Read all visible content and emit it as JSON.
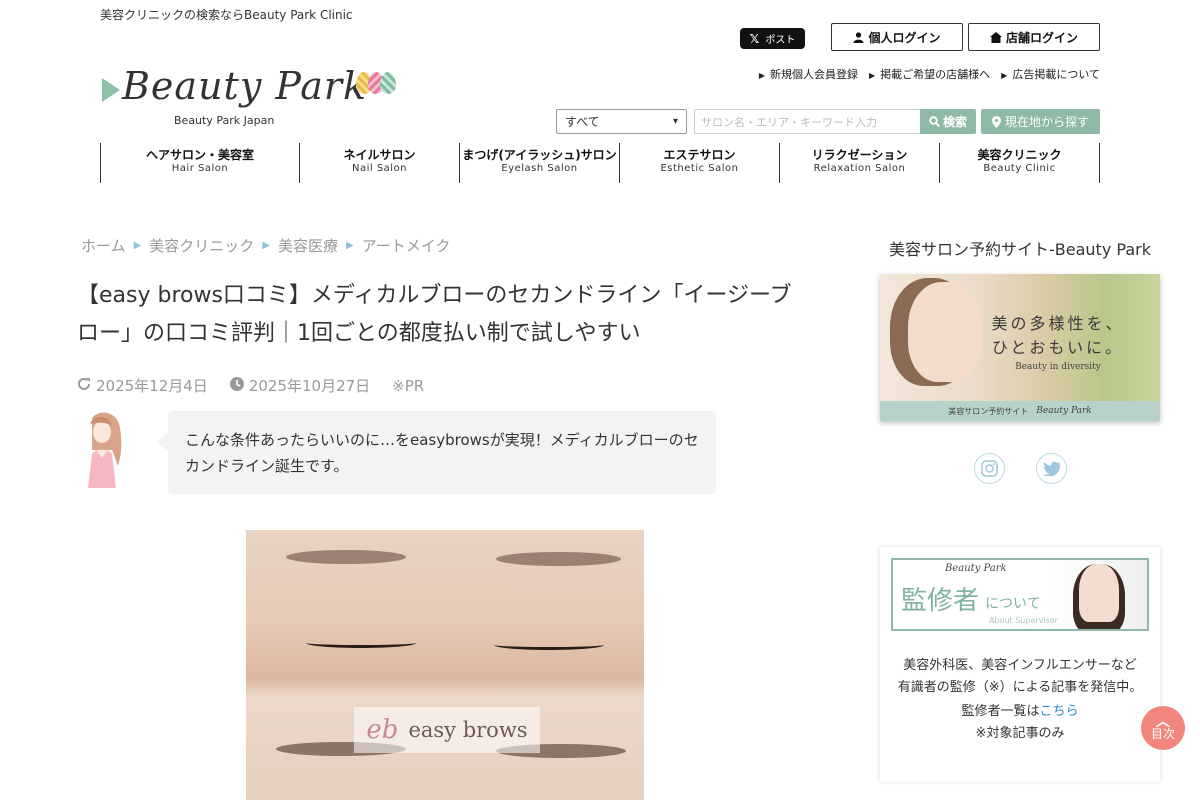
{
  "header": {
    "tagline": "美容クリニックの検索ならBeauty Park Clinic",
    "x_post_label": "ポスト",
    "personal_login": "個人ログイン",
    "shop_login": "店舗ログイン",
    "links": [
      "新規個人会員登録",
      "掲載ご希望の店舗様へ",
      "広告掲載について"
    ],
    "logo_text": "Beauty Park",
    "logo_sub": "Beauty Park Japan"
  },
  "search": {
    "category_selected": "すべて",
    "placeholder": "サロン名・エリア・キーワード入力",
    "search_label": "検索",
    "geo_label": "現在地から探す"
  },
  "nav": [
    {
      "jp": "ヘアサロン・美容室",
      "en": "Hair Salon"
    },
    {
      "jp": "ネイルサロン",
      "en": "Nail Salon"
    },
    {
      "jp": "まつげ(アイラッシュ)サロン",
      "en": "Eyelash Salon"
    },
    {
      "jp": "エステサロン",
      "en": "Esthetic Salon"
    },
    {
      "jp": "リラクゼーション",
      "en": "Relaxation Salon"
    },
    {
      "jp": "美容クリニック",
      "en": "Beauty Clinic"
    }
  ],
  "breadcrumb": [
    "ホーム",
    "美容クリニック",
    "美容医療",
    "アートメイク"
  ],
  "article": {
    "title": "【easy brows口コミ】メディカルブローのセカンドライン「イージーブロー」の口コミ評判｜1回ごとの都度払い制で試しやすい",
    "updated": "2025年12月4日",
    "published": "2025年10月27日",
    "pr": "※PR",
    "bubble": "こんな条件あったらいいのに…をeasybrowsが実現！メディカルブローのセカンドライン誕生です。",
    "hero_label": "easy brows"
  },
  "sidebar": {
    "title": "美容サロン予約サイト-Beauty Park",
    "banner_copy_1": "美の多様性を、",
    "banner_copy_2": "ひとおもいに。",
    "banner_copy_en": "Beauty in diversity",
    "banner_strip": "美容サロン予約サイト",
    "banner_strip_brand": "Beauty Park",
    "supervisor_brand": "Beauty Park",
    "supervisor_big": "監修者",
    "supervisor_small": "について",
    "supervisor_tiny": "About Supervisor",
    "supervisor_text_1": "美容外科医、美容インフルエンサーなど",
    "supervisor_text_2": "有識者の監修（※）による記事を発信中。",
    "supervisor_link_prefix": "監修者一覧は",
    "supervisor_link": "こちら",
    "supervisor_note": "※対象記事のみ"
  },
  "toc_label": "目次",
  "colors": {
    "accent_green": "#8fb9a7",
    "toc_coral": "#f3857f",
    "link_blue": "#2a8cc9",
    "breadcrumb_arrow": "#8ec5d9"
  }
}
